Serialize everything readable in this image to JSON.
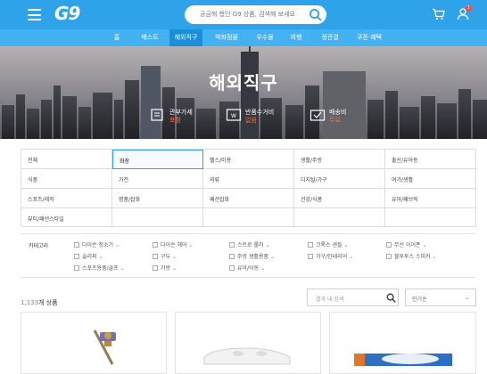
{
  "header": {
    "logo": "G9",
    "search_placeholder": "궁금해 했던 G9 상품, 검색해 보세요",
    "notification_count": "1"
  },
  "nav": [
    {
      "label": "홈"
    },
    {
      "label": "베스트"
    },
    {
      "label": "해외직구",
      "active": true
    },
    {
      "label": "박화점몰"
    },
    {
      "label": "우수몰"
    },
    {
      "label": "여행"
    },
    {
      "label": "정관결"
    },
    {
      "label": "쿠폰·혜택"
    }
  ],
  "hero": {
    "title": "해외직구",
    "benefits": [
      {
        "label": "관부가세",
        "value": "포함",
        "icon": "tax-icon"
      },
      {
        "label": "반품수거비",
        "value": "없음",
        "icon": "return-icon"
      },
      {
        "label": "배송비",
        "value": "무료",
        "icon": "delivery-icon"
      }
    ]
  },
  "categories": [
    "전체",
    "화장",
    "헬스/미용",
    "생활/주방",
    "출산/유아동",
    "식품",
    "가전",
    "의류",
    "디지털/가구",
    "여가/생활",
    "스포츠/레저",
    "명품/잡화",
    "패션잡화",
    "건강/식품",
    "유아/패브릭",
    "뷰티/패션스타일"
  ],
  "filters": {
    "title": "카테고리",
    "items": [
      "다이슨 청소기",
      "다이슨 헤어",
      "스트로 롤러",
      "크록스 샌들",
      "무선 이어폰",
      "슬리퍼",
      "구두",
      "주방 생활용품",
      "가구/인테리어",
      "블루투스 스피커",
      "스포츠용품/골프",
      "가방",
      "유아/아동"
    ]
  },
  "products": {
    "count": "1,133",
    "count_suffix": "개 상품",
    "search_placeholder": "결과 내 검색",
    "sort_label": "인기순"
  }
}
